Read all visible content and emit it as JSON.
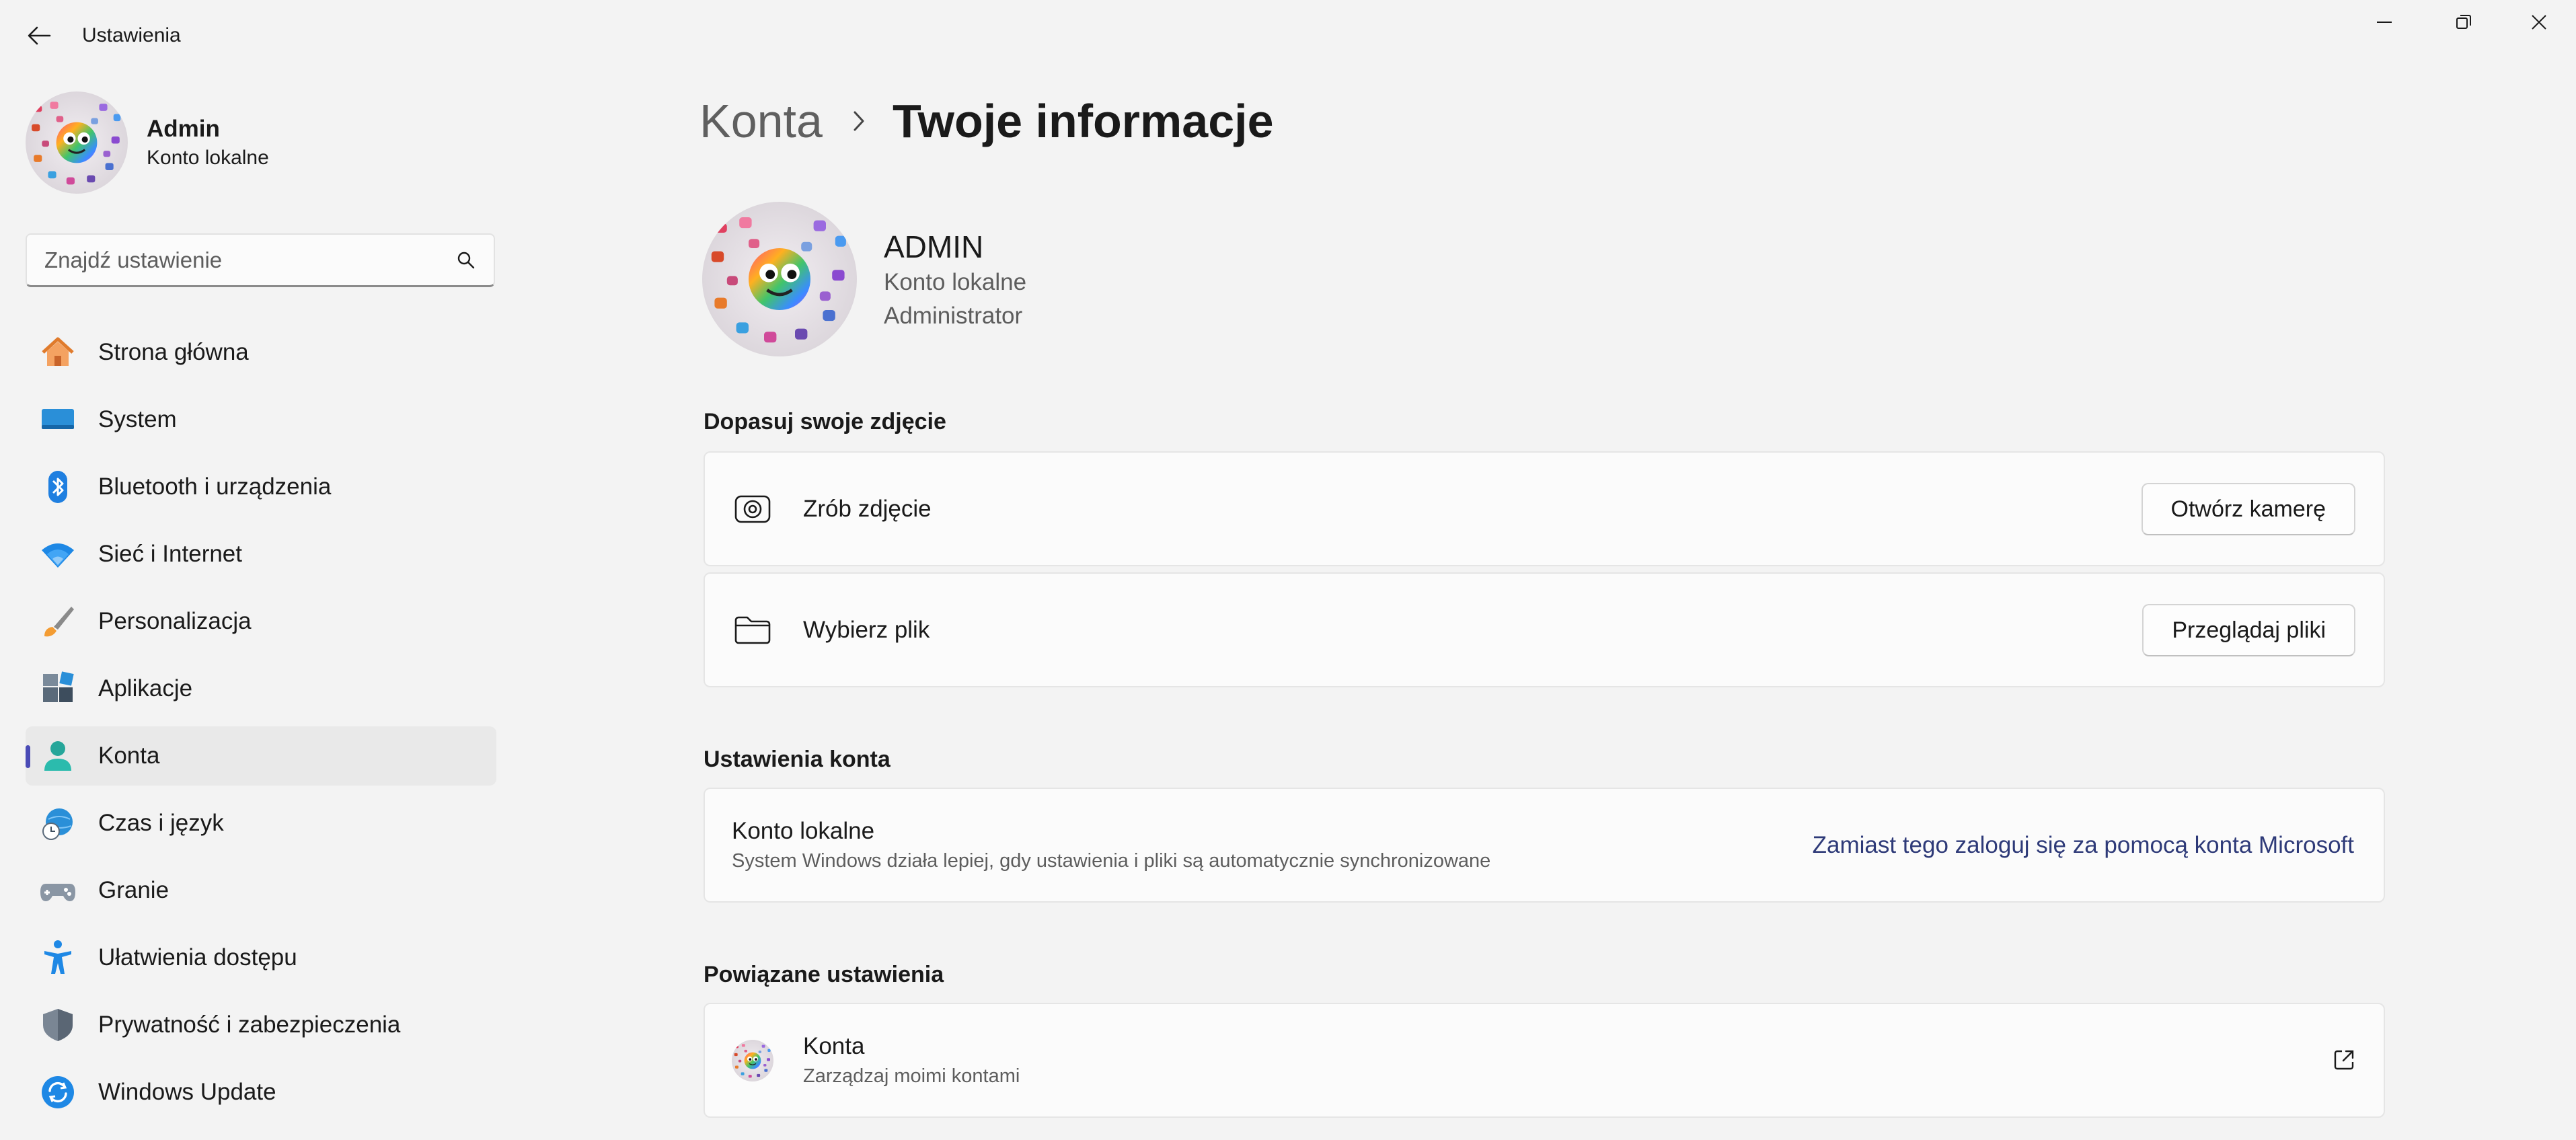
{
  "app": {
    "title": "Ustawienia"
  },
  "user": {
    "name": "Admin",
    "account_type": "Konto lokalne"
  },
  "search": {
    "placeholder": "Znajdź ustawienie"
  },
  "sidebar": {
    "items": [
      {
        "label": "Strona główna",
        "icon": "home-icon"
      },
      {
        "label": "System",
        "icon": "system-icon"
      },
      {
        "label": "Bluetooth i urządzenia",
        "icon": "bluetooth-icon"
      },
      {
        "label": "Sieć i Internet",
        "icon": "wifi-icon"
      },
      {
        "label": "Personalizacja",
        "icon": "brush-icon"
      },
      {
        "label": "Aplikacje",
        "icon": "apps-icon"
      },
      {
        "label": "Konta",
        "icon": "person-icon",
        "active": true
      },
      {
        "label": "Czas i język",
        "icon": "globe-clock-icon"
      },
      {
        "label": "Granie",
        "icon": "gamepad-icon"
      },
      {
        "label": "Ułatwienia dostępu",
        "icon": "accessibility-icon"
      },
      {
        "label": "Prywatność i zabezpieczenia",
        "icon": "shield-icon"
      },
      {
        "label": "Windows Update",
        "icon": "update-icon"
      }
    ]
  },
  "breadcrumb": {
    "parent": "Konta",
    "current": "Twoje informacje"
  },
  "profile": {
    "name": "ADMIN",
    "account_type": "Konto lokalne",
    "role": "Administrator"
  },
  "photo_section": {
    "title": "Dopasuj swoje zdjęcie",
    "take_photo": {
      "label": "Zrób zdjęcie",
      "button": "Otwórz kamerę"
    },
    "choose_file": {
      "label": "Wybierz plik",
      "button": "Przeglądaj pliki"
    }
  },
  "account_section": {
    "title": "Ustawienia konta",
    "local": {
      "label": "Konto lokalne",
      "description": "System Windows działa lepiej, gdy ustawienia i pliki są automatycznie synchronizowane",
      "link": "Zamiast tego zaloguj się za pomocą konta Microsoft"
    }
  },
  "related_section": {
    "title": "Powiązane ustawienia",
    "accounts": {
      "label": "Konta",
      "description": "Zarządzaj moimi kontami"
    }
  },
  "colors": {
    "accent": "#4a4bb6",
    "link": "#2e3a78"
  }
}
